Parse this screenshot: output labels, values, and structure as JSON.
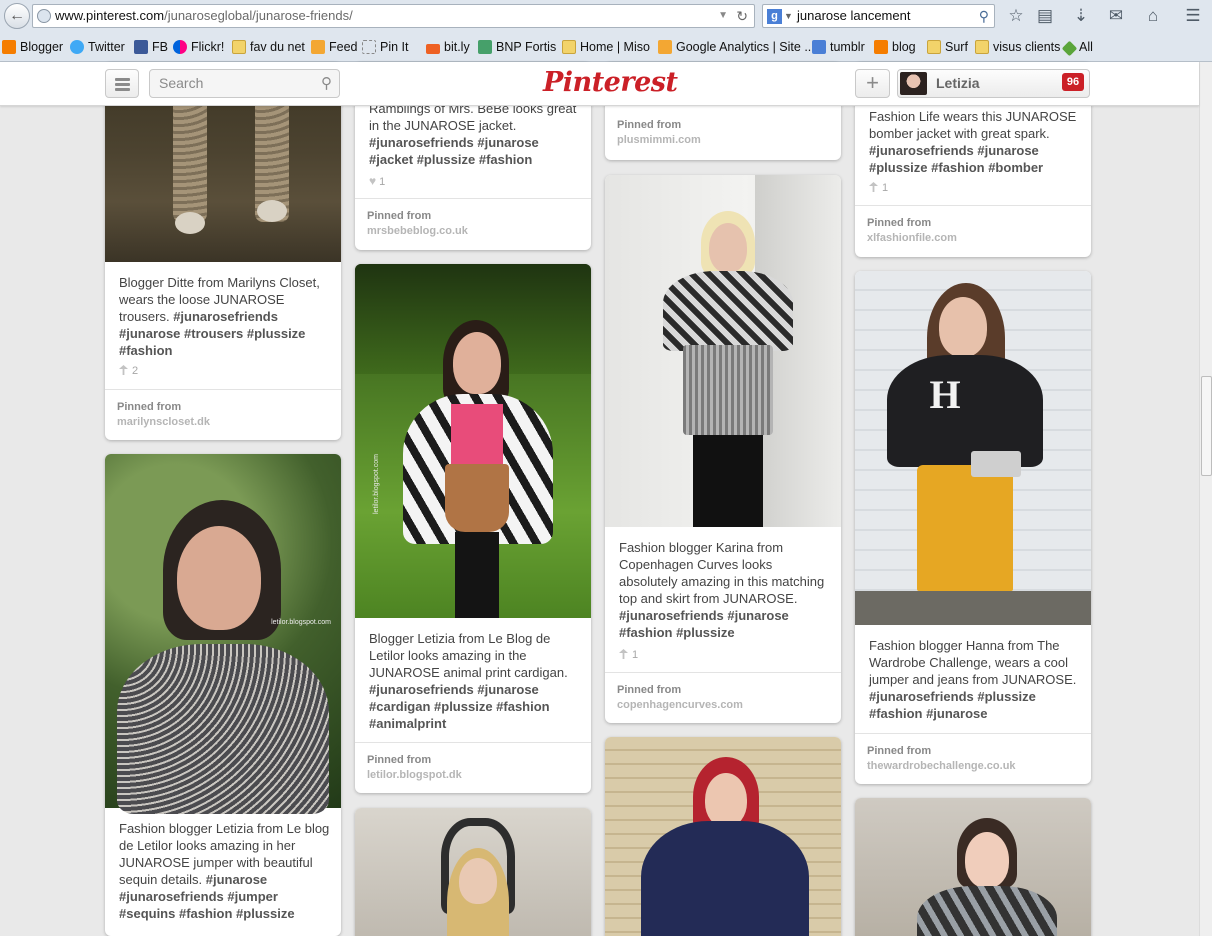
{
  "browser": {
    "url_domain": "www.pinterest.com",
    "url_path": "/junaroseglobal/junarose-friends/",
    "search_query": "junarose lancement",
    "search_engine_glyph": "g",
    "bookmarks": [
      {
        "label": "Blogger",
        "icon": "blogger"
      },
      {
        "label": "Twitter",
        "icon": "twitter"
      },
      {
        "label": "FB",
        "icon": "fb"
      },
      {
        "label": "Flickr!",
        "icon": "flickr"
      },
      {
        "label": "fav du net",
        "icon": "folder"
      },
      {
        "label": "Feed",
        "icon": "feed"
      },
      {
        "label": "Pin It",
        "icon": "dashed"
      },
      {
        "label": "bit.ly",
        "icon": "bitly"
      },
      {
        "label": "BNP Fortis",
        "icon": "green"
      },
      {
        "label": "Home | Miso",
        "icon": "folder"
      },
      {
        "label": "Google Analytics | Site ...",
        "icon": "feed"
      },
      {
        "label": "tumblr",
        "icon": "google"
      },
      {
        "label": "blog",
        "icon": "blogger"
      },
      {
        "label": "Surf",
        "icon": "folder"
      },
      {
        "label": "visus clients",
        "icon": "folder"
      },
      {
        "label": "All",
        "icon": "all"
      }
    ]
  },
  "pinterest": {
    "search_placeholder": "Search",
    "logo": "Pinterest",
    "user_name": "Letizia",
    "notification_count": "96",
    "add_glyph": "+"
  },
  "pins": {
    "col1_a": {
      "desc": "Blogger Ditte from Marilyns Closet, wears the loose JUNAROSE trousers.",
      "tags": "#junarosefriends #junarose #trousers #plussize #fashion",
      "repins": "2",
      "pinned_from": "Pinned from",
      "source": "marilynscloset.dk"
    },
    "col1_b": {
      "desc": "Fashion blogger Letizia from Le blog de Letilor looks amazing in her JUNAROSE jumper with beautiful sequin details.",
      "tags": "#junarose #junarosefriends #jumper #sequins #fashion #plussize",
      "watermark": "letilor.blogspot.com"
    },
    "col2_a": {
      "desc": "Ramblings of Mrs. BeBe looks great in the JUNAROSE jacket.",
      "tags": "#junarosefriends #junarose #jacket #plussize #fashion",
      "likes": "1",
      "pinned_from": "Pinned from",
      "source": "mrsbebeblog.co.uk"
    },
    "col2_b": {
      "desc": "Blogger Letizia from Le Blog de Letilor looks amazing in the JUNAROSE animal print cardigan.",
      "tags": "#junarosefriends #junarose #cardigan #plussize #fashion #animalprint",
      "pinned_from": "Pinned from",
      "source": "letilor.blogspot.dk",
      "watermark": "letilor.blogspot.com"
    },
    "col3_a": {
      "pinned_from": "Pinned from",
      "source": "plusmimmi.com"
    },
    "col3_b": {
      "desc": "Fashion blogger Karina from Copenhagen Curves looks absolutely amazing in this matching top and skirt from JUNAROSE.",
      "tags": "#junarosefriends #junarose #fashion #plussize",
      "repins": "1",
      "pinned_from": "Pinned from",
      "source": "copenhagencurves.com"
    },
    "col4_a": {
      "desc": "Fashion Life wears this JUNAROSE bomber jacket with great spark.",
      "tags": "#junarosefriends #junarose #plussize #fashion #bomber",
      "repins": "1",
      "pinned_from": "Pinned from",
      "source": "xlfashionfile.com"
    },
    "col4_b": {
      "desc": "Fashion blogger Hanna from The Wardrobe Challenge, wears a cool jumper and jeans from JUNAROSE.",
      "tags": "#junarosefriends #plussize #fashion #junarose",
      "pinned_from": "Pinned from",
      "source": "thewardrobechallenge.co.uk"
    }
  }
}
